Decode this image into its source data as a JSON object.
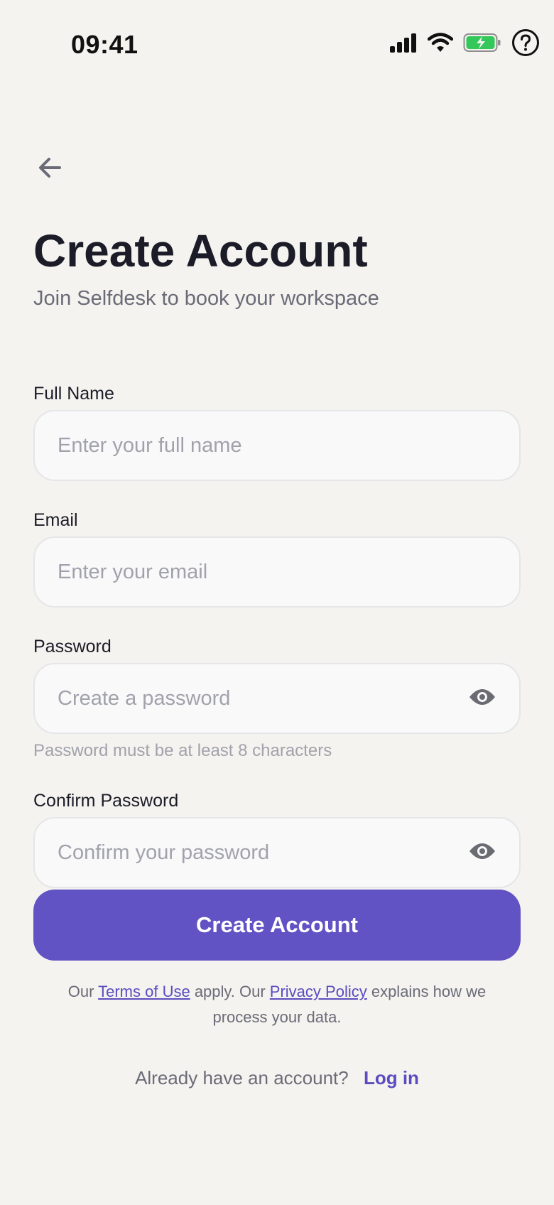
{
  "status_bar": {
    "time": "09:41",
    "icons": [
      "signal-icon",
      "wifi-icon",
      "battery-charging-icon",
      "help-icon"
    ]
  },
  "header": {
    "back_icon": "arrow-left-icon",
    "title": "Create Account",
    "subtitle": "Join Selfdesk to book your workspace"
  },
  "form": {
    "full_name": {
      "label": "Full Name",
      "placeholder": "Enter your full name",
      "value": ""
    },
    "email": {
      "label": "Email",
      "placeholder": "Enter your email",
      "value": ""
    },
    "password": {
      "label": "Password",
      "placeholder": "Create a password",
      "value": "",
      "hint": "Password must be at least 8 characters"
    },
    "confirm_password": {
      "label": "Confirm Password",
      "placeholder": "Confirm your password",
      "value": ""
    },
    "submit_label": "Create Account"
  },
  "legal": {
    "prefix": "Our ",
    "terms_link": "Terms of Use",
    "middle": " apply. Our ",
    "privacy_link": "Privacy Policy",
    "suffix": " explains how we process your data."
  },
  "login": {
    "prompt": "Already have an account?",
    "link": "Log in"
  },
  "colors": {
    "background": "#f4f3ef",
    "accent": "#6153c4",
    "battery": "#34c759"
  }
}
